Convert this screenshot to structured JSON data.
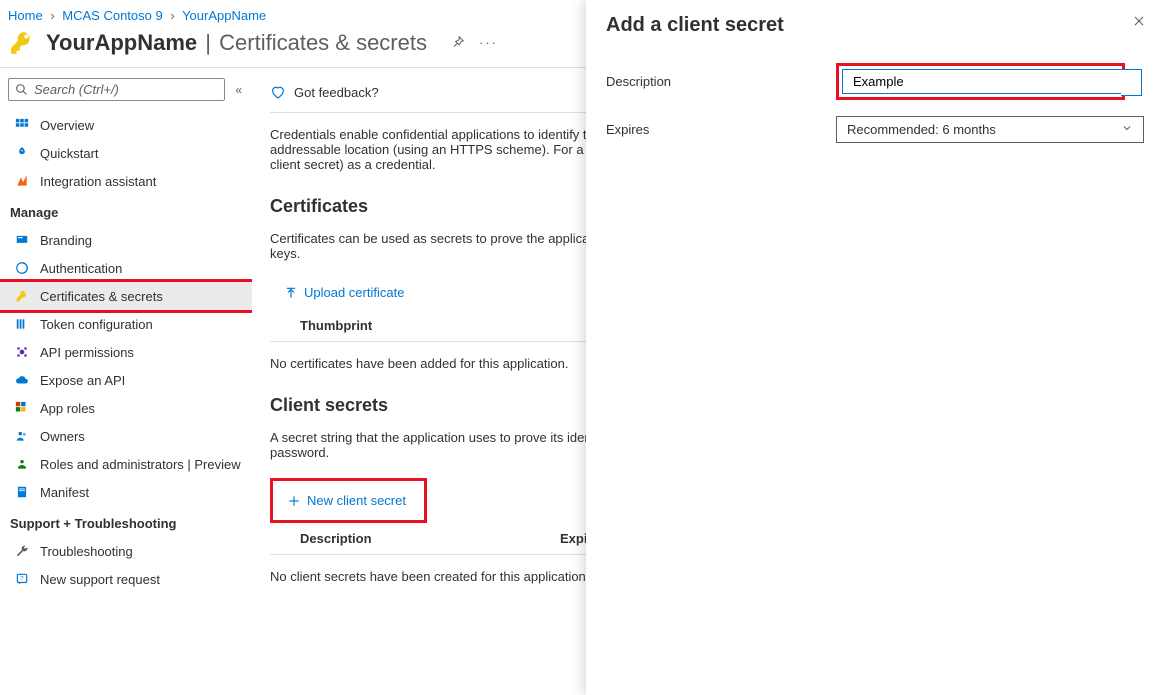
{
  "breadcrumb": {
    "home": "Home",
    "level1": "MCAS Contoso 9",
    "level2": "YourAppName"
  },
  "header": {
    "app_name": "YourAppName",
    "subtitle": "Certificates & secrets"
  },
  "search": {
    "placeholder": "Search (Ctrl+/)"
  },
  "sidebar": {
    "overview": "Overview",
    "quickstart": "Quickstart",
    "integration": "Integration assistant",
    "group_manage": "Manage",
    "branding": "Branding",
    "authentication": "Authentication",
    "cert_secrets": "Certificates & secrets",
    "token_config": "Token configuration",
    "api_permissions": "API permissions",
    "expose_api": "Expose an API",
    "app_roles": "App roles",
    "owners": "Owners",
    "roles_admins": "Roles and administrators | Preview",
    "manifest": "Manifest",
    "group_support": "Support + Troubleshooting",
    "troubleshooting": "Troubleshooting",
    "new_support": "New support request"
  },
  "content": {
    "feedback": "Got feedback?",
    "credentials_desc": "Credentials enable confidential applications to identify themselves to the authentication service when receiving tokens at a web addressable location (using an HTTPS scheme). For a higher level of assurance, we recommend using a certificate (instead of a client secret) as a credential.",
    "certificates_heading": "Certificates",
    "certificates_desc": "Certificates can be used as secrets to prove the application's identity when requesting a token. Also can be referred to as public keys.",
    "upload_certificate": "Upload certificate",
    "thumbprint": "Thumbprint",
    "no_certificates": "No certificates have been added for this application.",
    "client_secrets_heading": "Client secrets",
    "client_secrets_desc": "A secret string that the application uses to prove its identity when requesting a token. Also can be referred to as application password.",
    "new_client_secret": "New client secret",
    "col_description": "Description",
    "col_expires": "Expires",
    "no_secrets": "No client secrets have been created for this application."
  },
  "panel": {
    "title": "Add a client secret",
    "label_description": "Description",
    "label_expires": "Expires",
    "description_value": "Example",
    "expires_value": "Recommended: 6 months"
  }
}
